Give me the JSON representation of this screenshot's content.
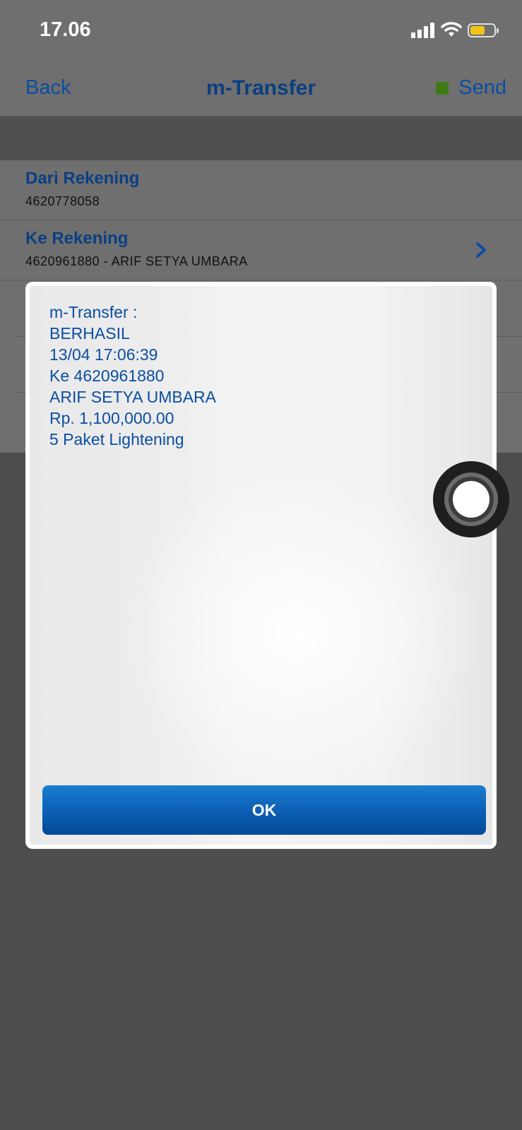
{
  "status_bar": {
    "time": "17.06"
  },
  "nav": {
    "back_label": "Back",
    "title": "m-Transfer",
    "send_label": "Send"
  },
  "form": {
    "from": {
      "label": "Dari Rekening",
      "value": "4620778058"
    },
    "to": {
      "label": "Ke Rekening",
      "value": "4620961880 - ARIF SETYA UMBARA"
    }
  },
  "dialog": {
    "lines": [
      "m-Transfer :",
      "BERHASIL",
      "13/04 17:06:39",
      "Ke 4620961880",
      "ARIF SETYA UMBARA",
      "Rp. 1,100,000.00",
      "5 Paket Lightening"
    ],
    "ok_label": "OK"
  },
  "colors": {
    "accent": "#0b4ea2",
    "title": "#0a3f82",
    "send_indicator": "#3e7b15",
    "battery": "#f2c517",
    "button_top": "#1a7fd0",
    "button_bottom": "#044a98"
  },
  "icons": [
    "signal-icon",
    "wifi-icon",
    "battery-icon",
    "chevron-right-icon",
    "assistive-touch-icon"
  ]
}
